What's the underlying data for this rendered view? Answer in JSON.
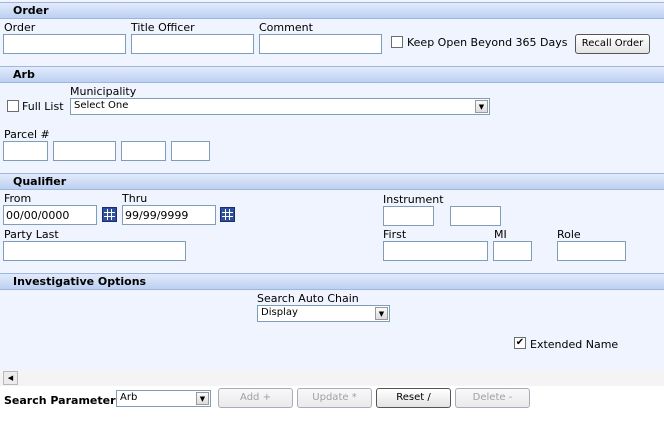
{
  "sections": {
    "order": "Order",
    "arb": "Arb",
    "qualifier": "Qualifier",
    "investigative": "Investigative Options"
  },
  "order": {
    "order_label": "Order",
    "order_value": "",
    "title_officer_label": "Title Officer",
    "title_officer_value": "",
    "comment_label": "Comment",
    "comment_value": "",
    "keep_open_label": "Keep Open Beyond 365 Days",
    "keep_open_checked": false,
    "recall_button": "Recall Order"
  },
  "arb": {
    "full_list_label": "Full List",
    "full_list_checked": false,
    "municipality_label": "Municipality",
    "municipality_selected": "Select One",
    "parcel_label": "Parcel #"
  },
  "qualifier": {
    "from_label": "From",
    "from_value": "00/00/0000",
    "thru_label": "Thru",
    "thru_value": "99/99/9999",
    "instrument_label": "Instrument",
    "party_last_label": "Party Last",
    "first_label": "First",
    "mi_label": "MI",
    "role_label": "Role"
  },
  "investigative": {
    "auto_chain_label": "Search Auto Chain",
    "auto_chain_selected": "Display",
    "extended_name_label": "Extended Name",
    "extended_name_checked": true
  },
  "search_params": {
    "label": "Search Parameters",
    "selected": "Arb",
    "add_button": "Add +",
    "update_button": "Update *",
    "reset_button": "Reset /",
    "delete_button": "Delete -"
  }
}
